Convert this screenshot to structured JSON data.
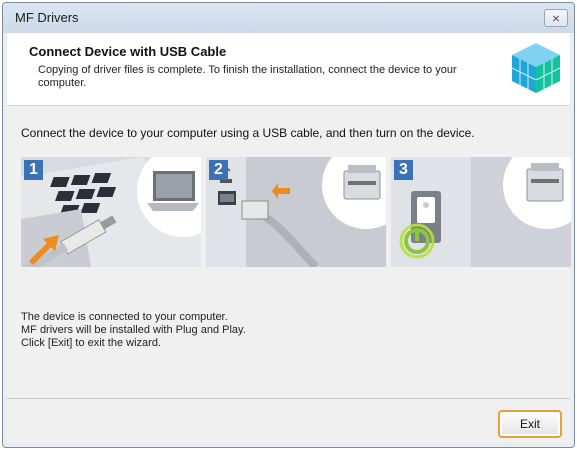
{
  "window": {
    "title": "MF Drivers",
    "close_label": "⨯"
  },
  "header": {
    "title": "Connect Device with USB Cable",
    "description": "Copying of driver files is complete. To finish the installation, connect the device to your computer."
  },
  "instruction": "Connect the device to your computer using a USB cable, and then turn on the device.",
  "steps": [
    {
      "number": "1",
      "icon": "laptop-usb-icon"
    },
    {
      "number": "2",
      "icon": "usb-port-printer-icon"
    },
    {
      "number": "3",
      "icon": "power-button-icon"
    }
  ],
  "status_lines": [
    "The device is connected to your computer.",
    "MF drivers will be installed with Plug and Play.",
    "Click [Exit] to exit the wizard."
  ],
  "buttons": {
    "exit": "Exit"
  },
  "colors": {
    "accent_orange": "#f08a1c",
    "step_blue": "#3a72b8",
    "power_green": "#8cc63f",
    "exit_border": "#e8a13a"
  }
}
